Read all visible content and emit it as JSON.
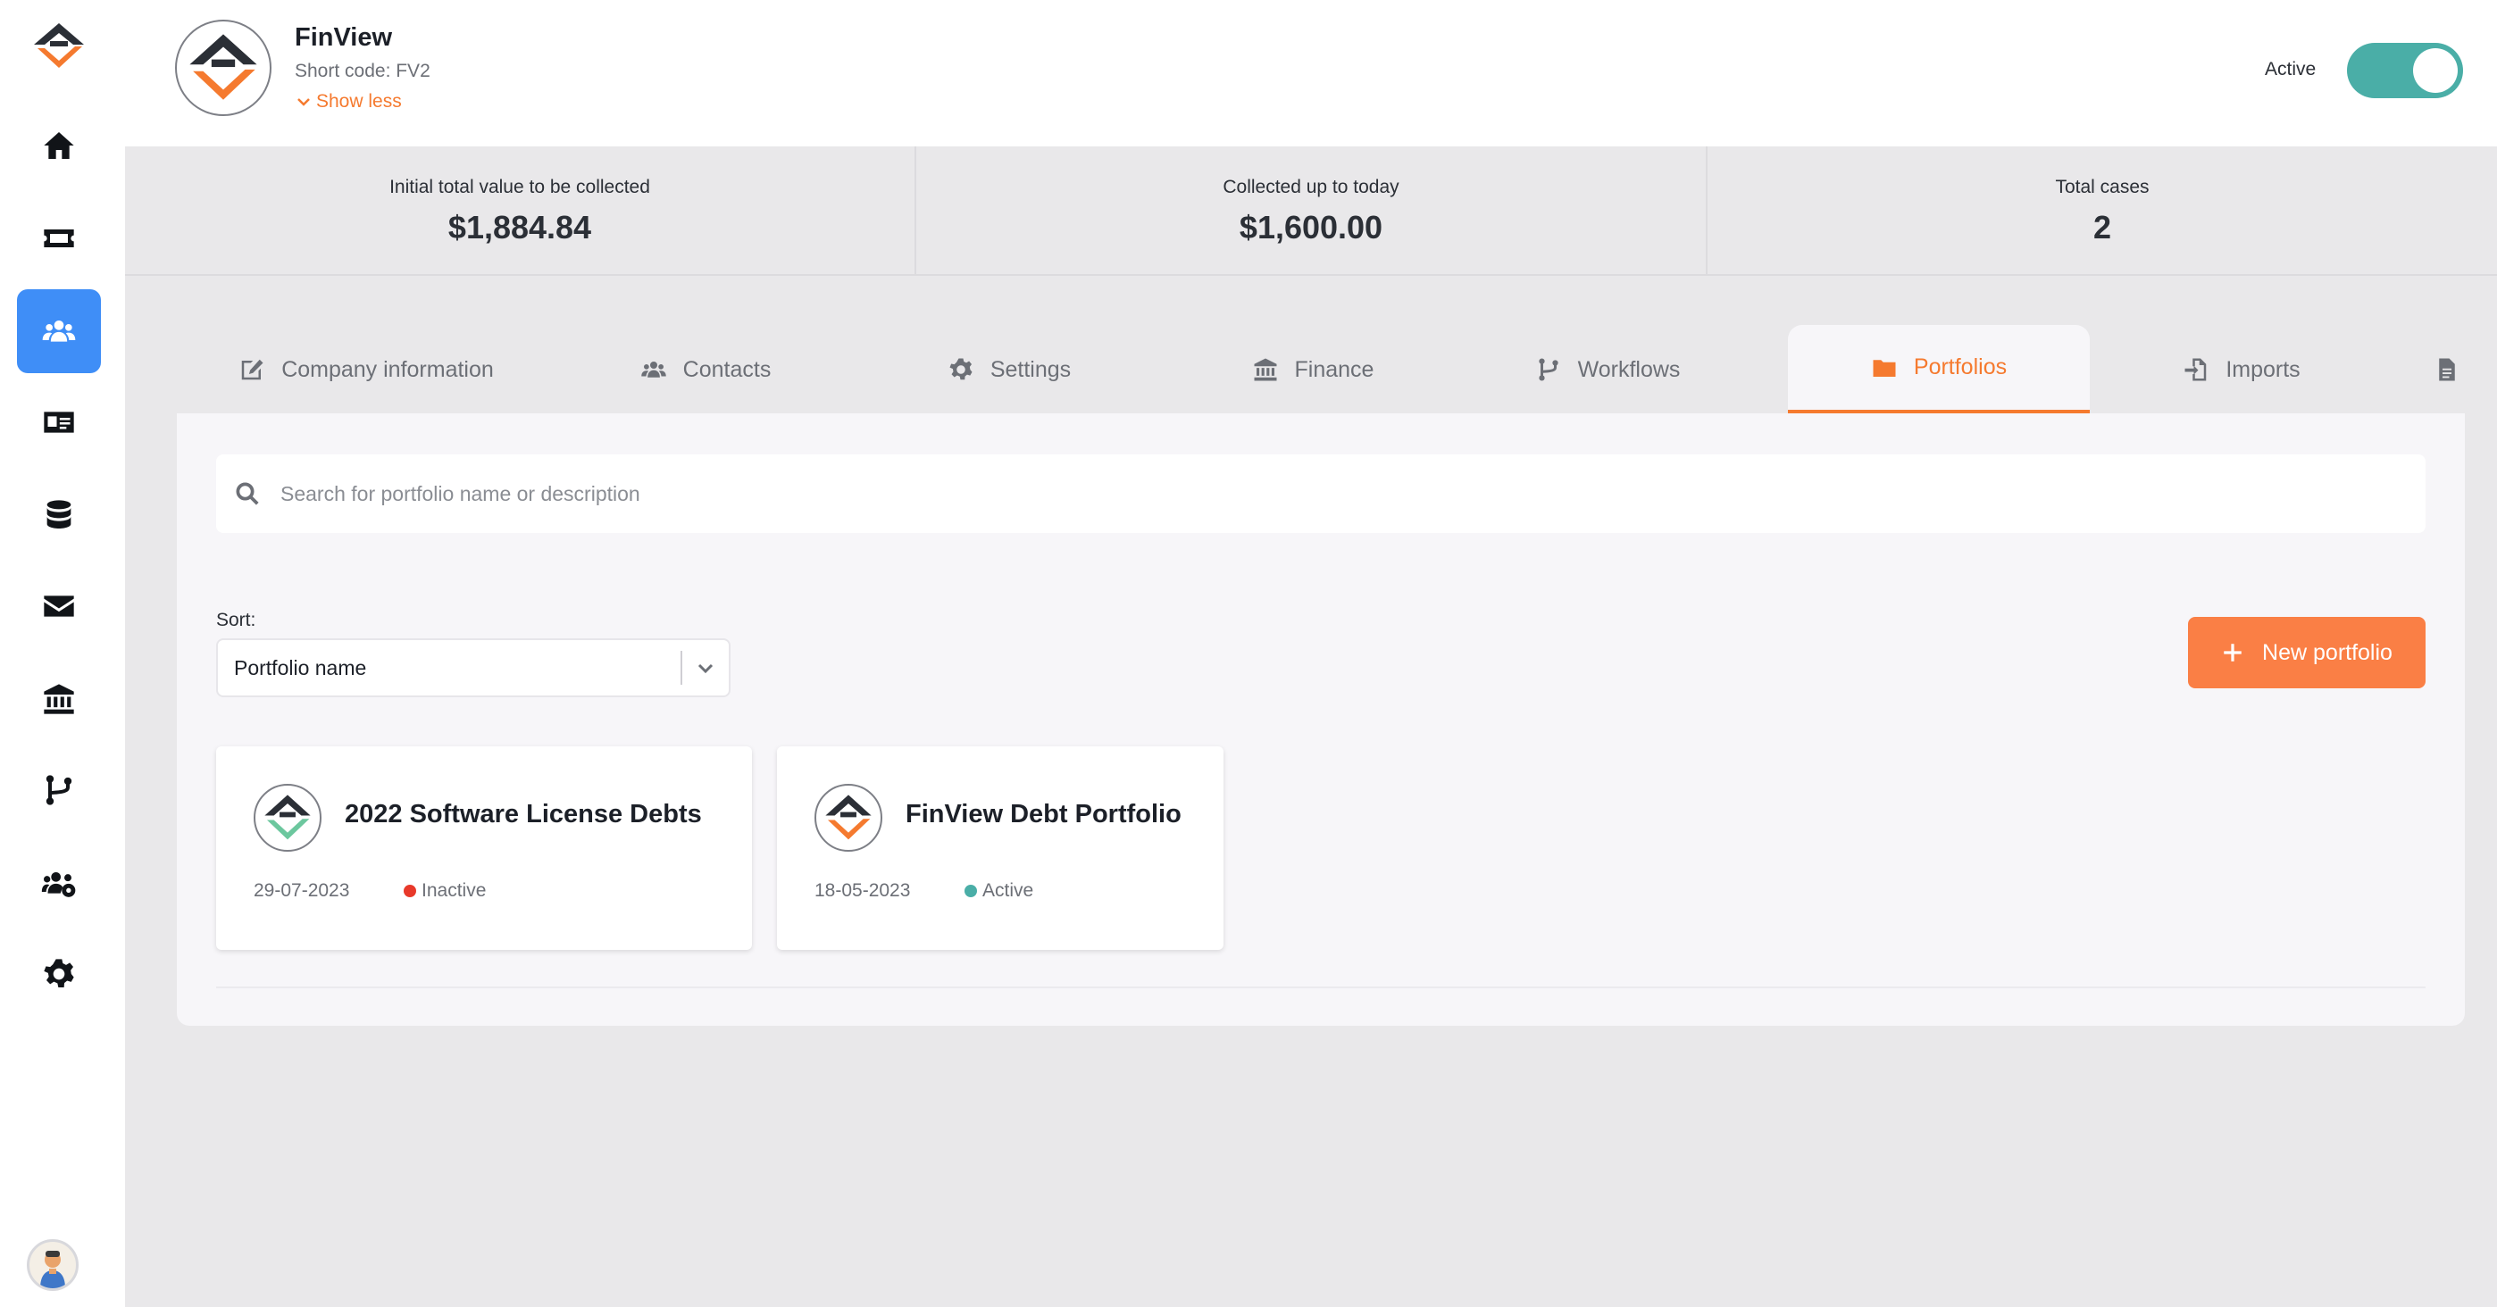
{
  "colors": {
    "accent": "#f57a2f",
    "sidebar_active": "#3f8ef7",
    "toggle_on": "#4aaea7",
    "inactive_dot": "#e8392a",
    "active_dot": "#4aaea7"
  },
  "sidebar": {
    "items": [
      {
        "icon": "home-icon"
      },
      {
        "icon": "ticket-icon"
      },
      {
        "icon": "users-icon",
        "active": true
      },
      {
        "icon": "id-card-icon"
      },
      {
        "icon": "database-icon"
      },
      {
        "icon": "envelope-icon"
      },
      {
        "icon": "bank-icon"
      },
      {
        "icon": "branch-icon"
      },
      {
        "icon": "users-cog-icon"
      },
      {
        "icon": "gear-icon"
      }
    ]
  },
  "header": {
    "company_name": "FinView",
    "short_code": "Short code: FV2",
    "show_less": "Show less",
    "status_label": "Active",
    "status_on": true
  },
  "stats": [
    {
      "label": "Initial total value to be collected",
      "value": "$1,884.84"
    },
    {
      "label": "Collected up to today",
      "value": "$1,600.00"
    },
    {
      "label": "Total cases",
      "value": "2"
    }
  ],
  "tabs": [
    {
      "label": "Company information",
      "icon": "edit-icon"
    },
    {
      "label": "Contacts",
      "icon": "users-icon"
    },
    {
      "label": "Settings",
      "icon": "gear-icon"
    },
    {
      "label": "Finance",
      "icon": "bank-icon"
    },
    {
      "label": "Workflows",
      "icon": "branch-icon"
    },
    {
      "label": "Portfolios",
      "icon": "folder-icon",
      "active": true
    },
    {
      "label": "Imports",
      "icon": "import-icon"
    },
    {
      "label": "",
      "icon": "document-icon"
    }
  ],
  "search": {
    "placeholder": "Search for portfolio name or description",
    "value": ""
  },
  "sort": {
    "label": "Sort:",
    "selected": "Portfolio name"
  },
  "new_portfolio_label": "New portfolio",
  "portfolios": [
    {
      "name": "2022 Software License Debts",
      "date": "29-07-2023",
      "status": "Inactive"
    },
    {
      "name": "FinView Debt Portfolio",
      "date": "18-05-2023",
      "status": "Active"
    }
  ]
}
